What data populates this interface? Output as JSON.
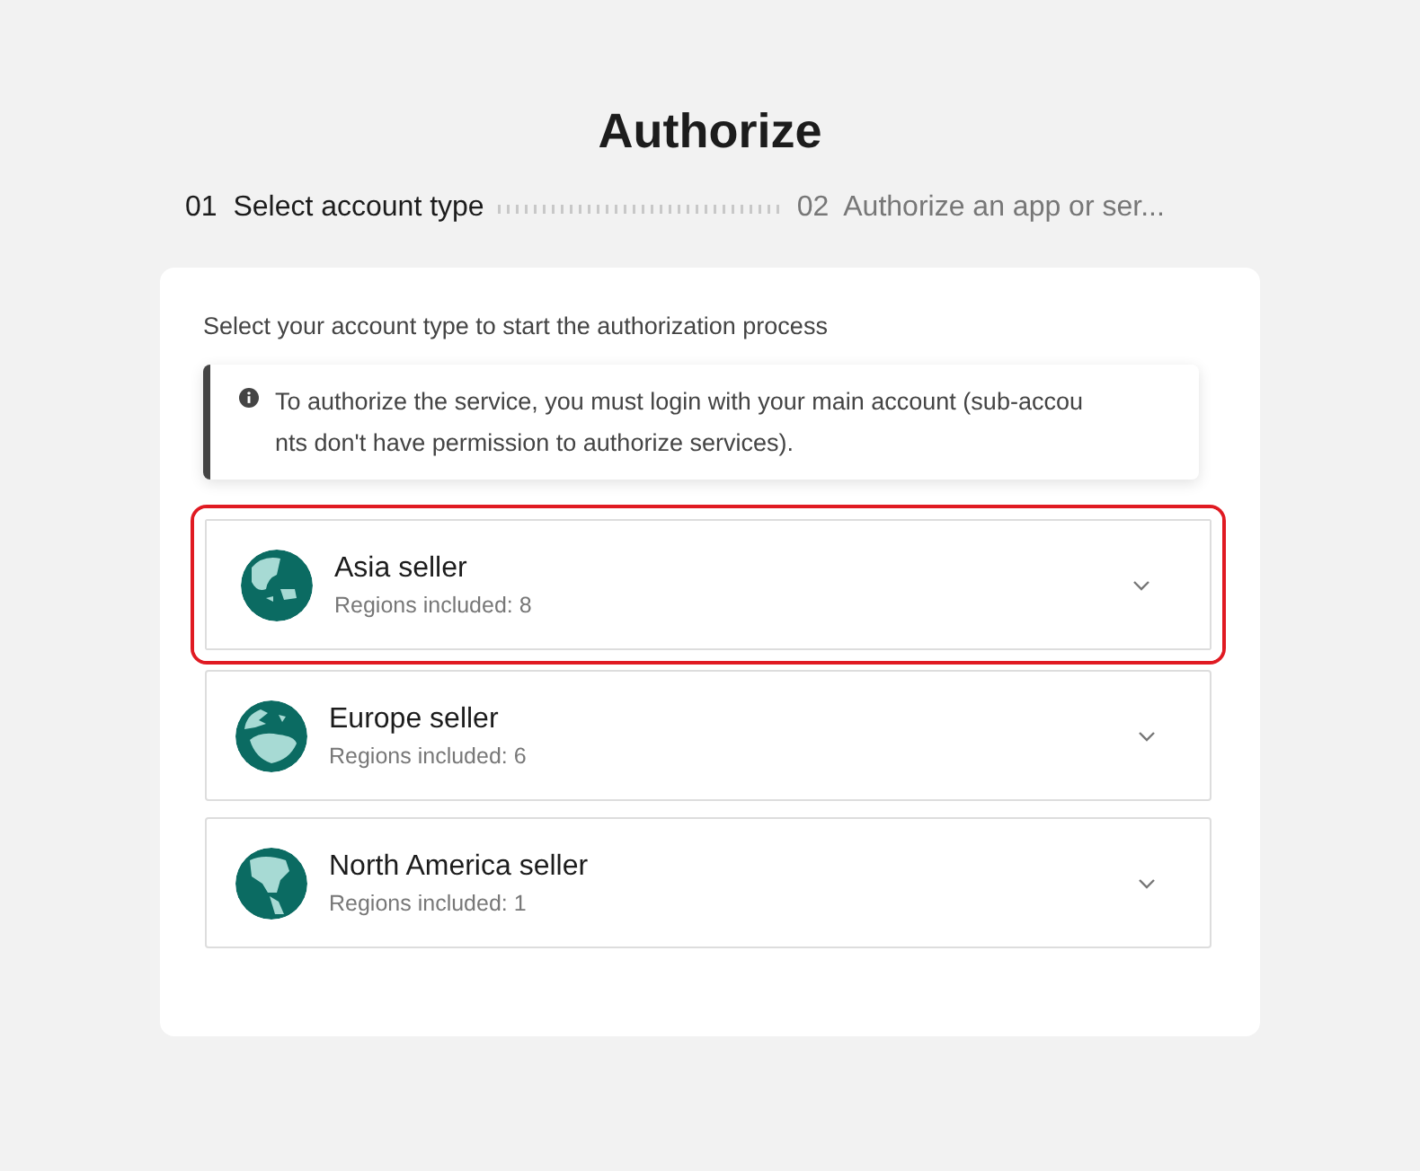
{
  "title": "Authorize",
  "steps": [
    {
      "number": "01",
      "label": "Select account type",
      "selected": true
    },
    {
      "number": "02",
      "label": "Authorize an app or ser...",
      "selected": false
    }
  ],
  "card": {
    "prompt": "Select your account type to start the authorization process",
    "notice": {
      "lines": [
        "To authorize the service, you must login with your main account (sub-accou",
        "nts don't have permission to authorize services)."
      ]
    },
    "accounts": [
      {
        "name": "Asia seller",
        "regions": "Regions included: 8",
        "highlighted": true,
        "expanded": false,
        "kind": "asia"
      },
      {
        "name": "Europe seller",
        "regions": "Regions included: 6",
        "highlighted": false,
        "expanded": false,
        "kind": "europe"
      },
      {
        "name": "North America seller",
        "regions": "Regions included: 1",
        "highlighted": false,
        "expanded": false,
        "kind": "america"
      }
    ]
  }
}
